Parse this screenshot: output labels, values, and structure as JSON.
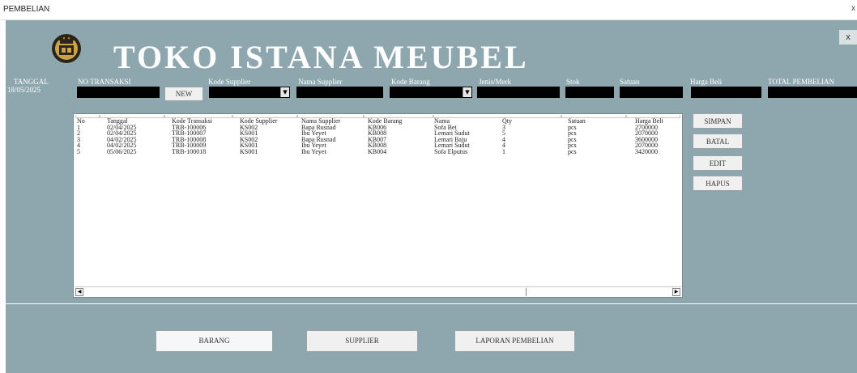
{
  "window": {
    "title": "PEMBELIAN",
    "close_label": "x"
  },
  "header": {
    "title": "TOKO ISTANA MEUBEL",
    "close_label": "x",
    "logo_icon": "crown-emblem-icon"
  },
  "form": {
    "tanggal_label": "TANGGAL",
    "tanggal_value": "18/05/2025",
    "no_transaksi_label": "NO TRANSAKSI",
    "new_button": "NEW",
    "kode_supplier_label": "Kode Supplier",
    "nama_supplier_label": "Nama Supplier",
    "kode_barang_label": "Kode Barang",
    "jenis_merk_label": "Jenis/Merk",
    "stok_label": "Stok",
    "satuan_label": "Satuan",
    "harga_beli_label": "Harga Beli",
    "total_pembelian_label": "TOTAL PEMBELIAN"
  },
  "table": {
    "columns": [
      "No",
      "Tanggal",
      "Kode Transaksi",
      "Kode Supplier",
      "Nama Supplier",
      "Kode Barang",
      "Nama",
      "Qty",
      "Satuan",
      "Harga Beli"
    ],
    "rows": [
      [
        "1",
        "02/04/2025",
        "TRB-100006",
        "KS002",
        "Bapa Rusnad",
        "KB006",
        "Sofa Bet",
        "3",
        "pcs",
        "2700000"
      ],
      [
        "2",
        "02/04/2025",
        "TRB-100007",
        "KS001",
        "Ibu Yeyet",
        "KB008",
        "Lemari Sudut",
        "5",
        "pcs",
        "2070000"
      ],
      [
        "3",
        "04/02/2025",
        "TRB-100008",
        "KS002",
        "Bapa Rusnad",
        "KB007",
        "Lemari Baju",
        "4",
        "pcs",
        "3600000"
      ],
      [
        "4",
        "04/02/2025",
        "TRB-100009",
        "KS001",
        "Ibu Yeyet",
        "KB008",
        "Lemari Sudut",
        "4",
        "pcs",
        "2070000"
      ],
      [
        "5",
        "05/06/2025",
        "TRB-100018",
        "KS001",
        "Ibu Yeyet",
        "KB004",
        "Sofa Elputus",
        "1",
        "pcs",
        "3420000"
      ]
    ]
  },
  "actions": {
    "simpan": "SIMPAN",
    "batal": "BATAL",
    "edit": "EDIT",
    "hapus": "HAPUS"
  },
  "nav": {
    "barang": "BARANG",
    "supplier": "SUPPLIER",
    "laporan": "LAPORAN PEMBELIAN"
  },
  "colors": {
    "background": "#8ea7ae",
    "field": "#000000",
    "button": "#f0f0f0"
  }
}
